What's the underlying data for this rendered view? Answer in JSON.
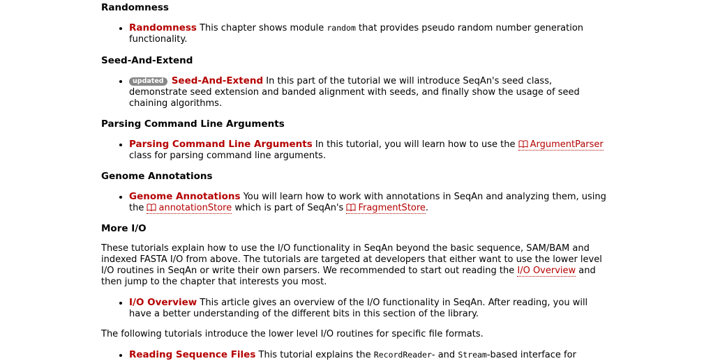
{
  "sections": {
    "randomness": {
      "heading": "Randomness",
      "item_title": "Randomness",
      "desc_pre": "This chapter shows module",
      "code": "random",
      "desc_post": "that provides pseudo random number generation functionality."
    },
    "seed": {
      "heading": "Seed-And-Extend",
      "badge": "updated",
      "item_title": "Seed-And-Extend",
      "desc": "In this part of the tutorial we will introduce SeqAn's seed class, demonstrate seed extension and banded alignment with seeds, and finally show the usage of seed chaining algorithms."
    },
    "parsing": {
      "heading": "Parsing Command Line Arguments",
      "item_title": "Parsing Command Line Arguments",
      "desc_pre": "In this tutorial, you will learn how to use the",
      "doc_link": "ArgumentParser",
      "desc_post": "class for parsing command line arguments."
    },
    "genome": {
      "heading": "Genome Annotations",
      "item_title": "Genome Annotations",
      "desc_pre": "You will learn how to work with annotations in SeqAn and analyzing them, using the",
      "doc_link1": "annotationStore",
      "desc_mid": "which is part of SeqAn's",
      "doc_link2": "FragmentStore",
      "desc_post": "."
    },
    "moreio": {
      "heading": "More I/O",
      "intro_pre": "These tutorials explain how to use the I/O functionality in SeqAn beyond the basic sequence, SAM/BAM and indexed FASTA I/O from above. The tutorials are targeted at developers that either want to use the lower level I/O routines in SeqAn or write their own parsers. We recommended to start out reading the",
      "intro_link": "I/O Overview",
      "intro_post": "and then jump to the chapter that interests you most.",
      "item_title": "I/O Overview",
      "item_desc": "This article gives an overview of the I/O functionality in SeqAn. After reading, you will have a better understanding of the different bits in this section of the library.",
      "following": "The following tutorials introduce the lower level I/O routines for specific file formats.",
      "item2_title": "Reading Sequence Files",
      "item2_pre": "This tutorial explains the",
      "item2_code1": "RecordReader",
      "item2_mid": "- and",
      "item2_code2": "Stream",
      "item2_post": "-based interface for"
    }
  },
  "colors": {
    "link": "#b50000",
    "badge": "#888888"
  },
  "icons": {
    "doc_link": "book-icon"
  }
}
